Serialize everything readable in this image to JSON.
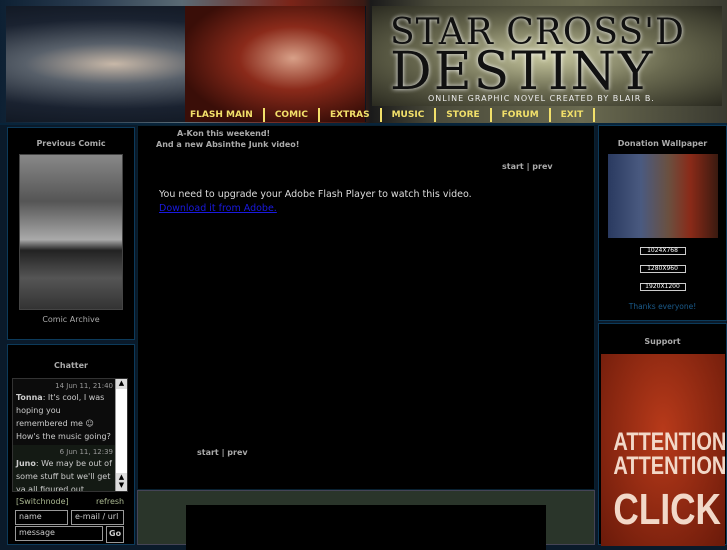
{
  "header": {
    "logo_line1": "STAR CROSS'D",
    "logo_line2": "DESTINY",
    "tagline": "ONLINE GRAPHIC NOVEL CREATED BY BLAIR B."
  },
  "nav": [
    "FLASH MAIN",
    "COMIC",
    "EXTRAS",
    "MUSIC",
    "STORE",
    "FORUM",
    "EXIT"
  ],
  "left": {
    "prev_title": "Previous Comic",
    "archive": "Comic Archive",
    "chatter_title": "Chatter",
    "messages": [
      {
        "time": "14 Jun 11, 21:40",
        "user": "Tonna",
        "text": ": It's cool, I was hoping you remembered me ☺ How's the music going?"
      },
      {
        "time": "6 Jun 11, 12:39",
        "user": "Juno",
        "text": ": We may be out of some stuff but we'll get ya all figured out. Really"
      }
    ],
    "switch": "[Switchnode]",
    "refresh": "refresh",
    "name_ph": "name",
    "email_ph": "e-mail / url",
    "msg_ph": "message",
    "go": "Go"
  },
  "center": {
    "news1": "A-Kon this weekend!",
    "news2": "And a new Absinthe Junk video!",
    "start": "start",
    "sep": "|",
    "prev": "prev",
    "flash_msg": "You need to upgrade your Adobe Flash Player to watch this video.",
    "flash_link": "Download it from Adobe."
  },
  "right": {
    "donation_title": "Donation Wallpaper",
    "sizes": [
      "1024X768",
      "1280X960",
      "1920X1200"
    ],
    "thanks": "Thanks everyone!",
    "support_title": "Support",
    "ad_line1": "ATTENTION",
    "ad_line2": "ATTENTION",
    "ad_line3": "CLICK"
  }
}
